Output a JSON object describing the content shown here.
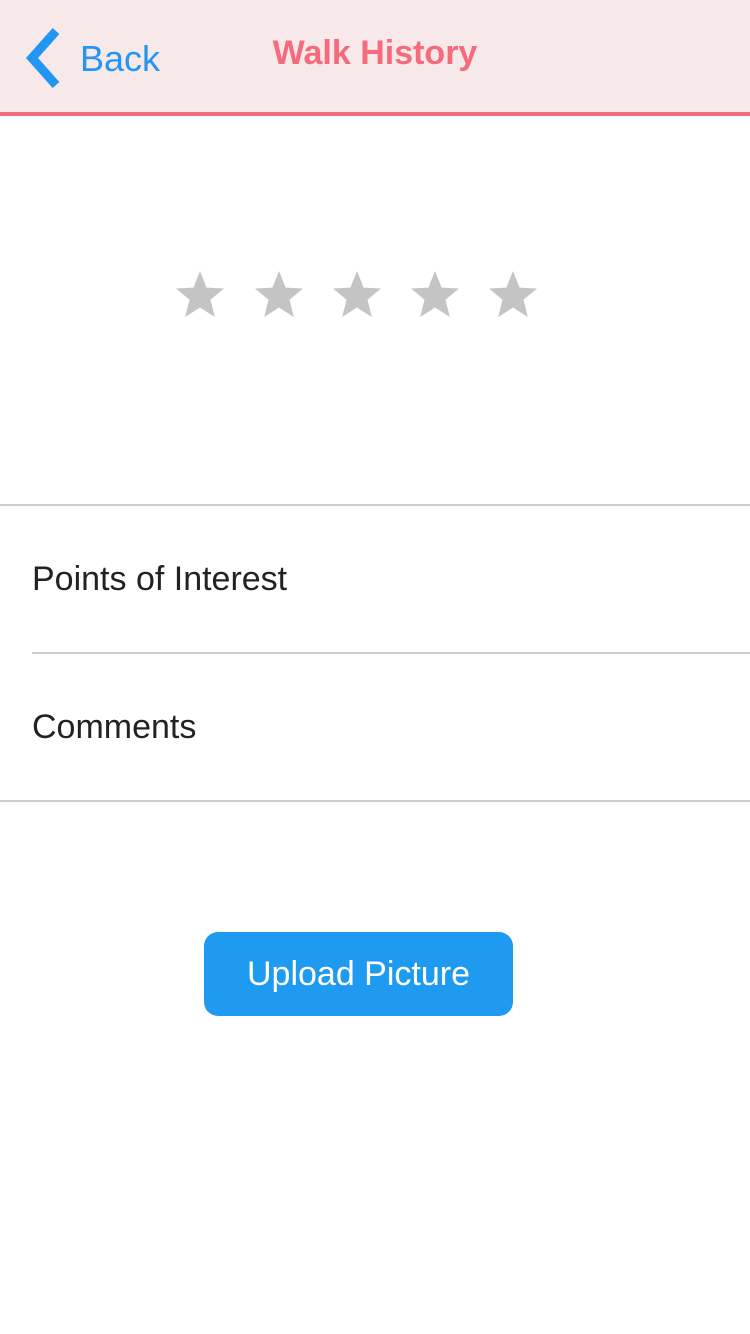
{
  "header": {
    "back_label": "Back",
    "title": "Walk History",
    "background_color": "#f7e8e9",
    "accent_color": "#f56b7b",
    "back_color": "#2196f3"
  },
  "rating": {
    "value": 0,
    "max": 5,
    "star_icon": "star-icon",
    "empty_color": "#c4c4c4"
  },
  "list": {
    "items": [
      {
        "label": "Points of Interest"
      },
      {
        "label": "Comments"
      }
    ]
  },
  "actions": {
    "upload_label": "Upload Picture",
    "upload_color": "#1e9bf0"
  }
}
